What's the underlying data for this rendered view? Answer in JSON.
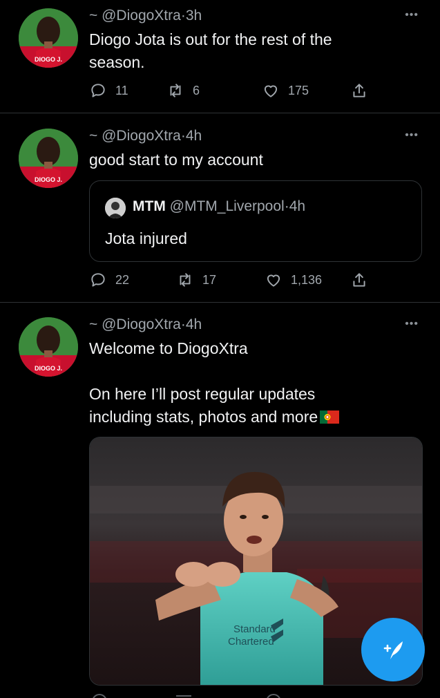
{
  "tweets": [
    {
      "handle": "@DiogoXtra",
      "separator": "·",
      "time": "3h",
      "text": "Diogo Jota is out for the rest of the\nseason.",
      "replies": "11",
      "retweets": "6",
      "likes": "175"
    },
    {
      "handle": "@DiogoXtra",
      "separator": "·",
      "time": "4h",
      "text": "good start to my account",
      "quote": {
        "name": "MTM",
        "handle": "@MTM_Liverpool",
        "separator": "·",
        "time": "4h",
        "text": "Jota injured"
      },
      "replies": "22",
      "retweets": "17",
      "likes": "1,136"
    },
    {
      "handle": "@DiogoXtra",
      "separator": "·",
      "time": "4h",
      "text_line1": "Welcome to DiogoXtra",
      "text_line2": "On here I’ll post regular updates\nincluding stats, photos and more",
      "media_sponsor_line1": "Standard",
      "media_sponsor_line2": "Chartered"
    }
  ],
  "avatar_shirt_text": "DIOGO J.",
  "more_label": "•••",
  "icons": {
    "reply": "reply-icon",
    "retweet": "retweet-icon",
    "like": "heart-icon",
    "share": "share-icon",
    "compose": "compose-tweet-icon",
    "flag": "portugal-flag-icon"
  },
  "colors": {
    "background": "#000000",
    "accent": "#1d9bf0",
    "secondary_text": "#a1a7ad",
    "divider": "#2f3336"
  }
}
